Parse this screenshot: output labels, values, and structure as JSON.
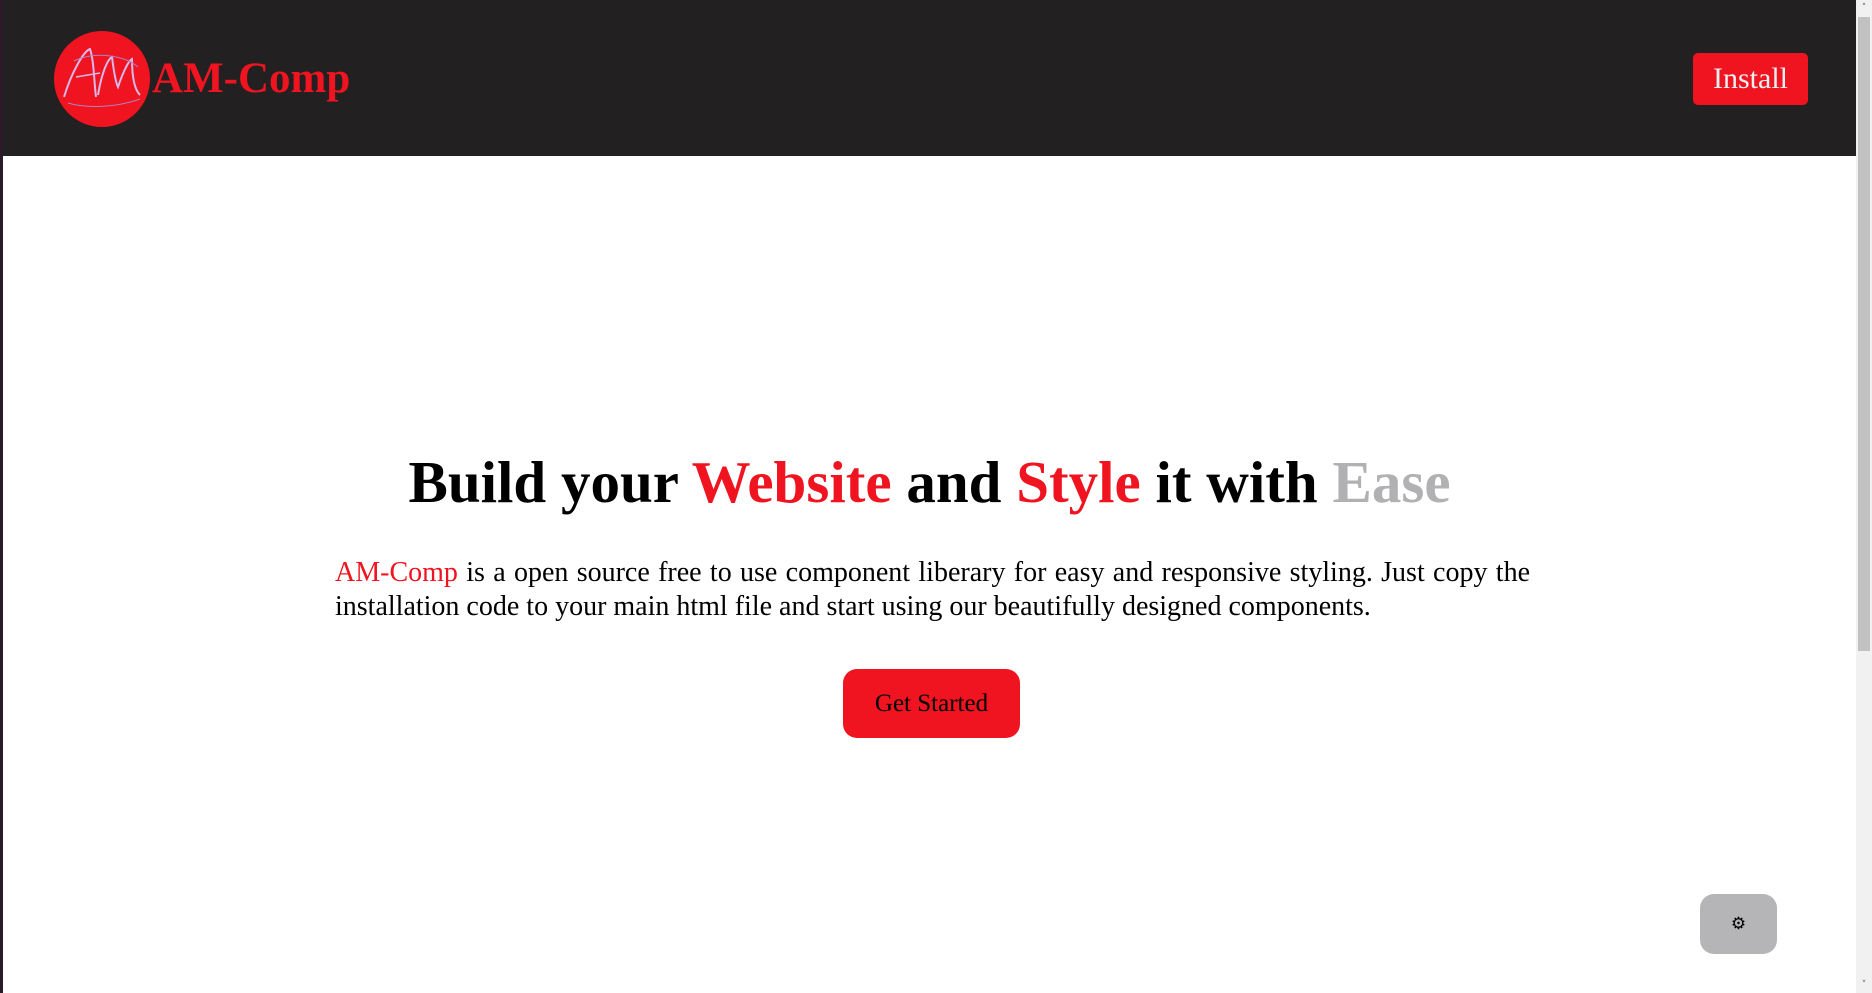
{
  "navbar": {
    "brand_name": "AM-Comp",
    "logo_monogram": "AM",
    "install_label": "Install"
  },
  "hero": {
    "title_parts": {
      "p1": "Build your ",
      "p2": "Website",
      "p3": " and ",
      "p4": "Style",
      "p5": " it with ",
      "p6": "Ease"
    },
    "desc_brand": "AM-Comp",
    "desc_text": " is a open source free to use component liberary for easy and responsive styling. Just copy the installation code to your main html file and start using our beautifully designed components.",
    "cta_label": "Get Started"
  },
  "theme_toggle": {
    "icon": "gear-icon",
    "glyph": "⚙"
  },
  "scrollbar": {
    "up_glyph": "˄",
    "down_glyph": "˅"
  },
  "colors": {
    "accent": "#ef1420",
    "navbar_bg": "#222020",
    "muted": "#b1b1b3",
    "toggle_bg": "#b5b5b8"
  }
}
